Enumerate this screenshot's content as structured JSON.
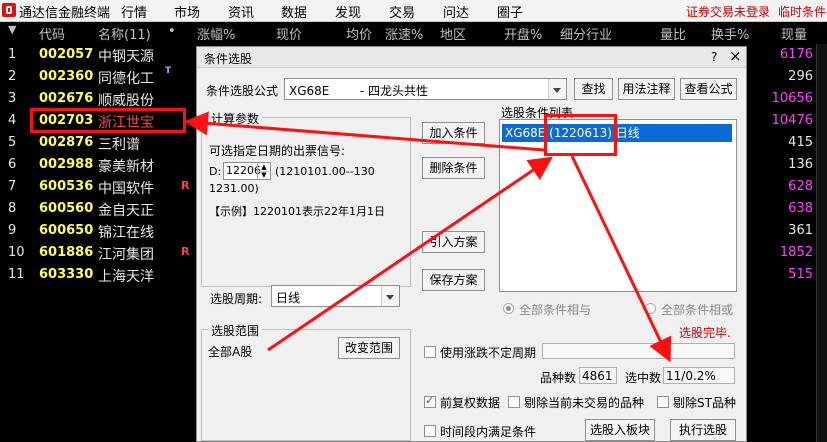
{
  "topbar": {
    "app_title": "通达信金融终端",
    "menus": [
      "行情",
      "市场",
      "资讯",
      "数据",
      "发现",
      "交易",
      "问达",
      "圈子"
    ],
    "warn_login": "证券交易未登录",
    "warn_temp": "临时条件"
  },
  "table": {
    "headers": [
      "代码",
      "名称(11)",
      "•",
      "涨幅%",
      "现价",
      "均价",
      "涨速%",
      "地区",
      "开盘%",
      "细分行业",
      "量比",
      "换手%",
      "现量"
    ],
    "rows": [
      {
        "idx": "1",
        "code": "002057",
        "name": "中钢天源",
        "flag": "",
        "right": "6176",
        "right_color": "#ff40ff"
      },
      {
        "idx": "2",
        "code": "002360",
        "name": "同德化工",
        "flag": "T",
        "right": "296",
        "right_color": "#e8e8e8"
      },
      {
        "idx": "3",
        "code": "002676",
        "name": "顺威股份",
        "flag": "",
        "right": "10656",
        "right_color": "#ff40ff"
      },
      {
        "idx": "4",
        "code": "002703",
        "name": "浙江世宝",
        "flag": "",
        "right": "10476",
        "right_color": "#ff40ff"
      },
      {
        "idx": "5",
        "code": "002876",
        "name": "三利谱",
        "flag": "",
        "right": "415",
        "right_color": "#e8e8e8"
      },
      {
        "idx": "6",
        "code": "002988",
        "name": "豪美新材",
        "flag": "",
        "right": "136",
        "right_color": "#e8e8e8"
      },
      {
        "idx": "7",
        "code": "600536",
        "name": "中国软件",
        "flag": "R",
        "right": "628",
        "right_color": "#ff40ff"
      },
      {
        "idx": "8",
        "code": "600560",
        "name": "金自天正",
        "flag": "",
        "right": "638",
        "right_color": "#ff40ff"
      },
      {
        "idx": "9",
        "code": "600650",
        "name": "锦江在线",
        "flag": "",
        "right": "361",
        "right_color": "#e8e8e8"
      },
      {
        "idx": "10",
        "code": "601886",
        "name": "江河集团",
        "flag": "R",
        "right": "1852",
        "right_color": "#ff40ff"
      },
      {
        "idx": "11",
        "code": "603330",
        "name": "上海天洋",
        "flag": "",
        "right": "515",
        "right_color": "#ff40ff"
      }
    ]
  },
  "dialog": {
    "title": "条件选股",
    "help_btn": "?",
    "close_btn": "×",
    "formula_label": "条件选股公式",
    "formula_value": "XG68E        - 四龙头共性",
    "btn_find": "查找",
    "btn_usage": "用法注释",
    "btn_view": "查看公式",
    "params_group": "计算参数",
    "param_desc": "可选指定日期的出票信号:",
    "param_d_label": "D:",
    "param_d_value": "12206",
    "param_range": "(1210101.00--130",
    "param_range2": "1231.00)",
    "param_example": "【示例】1220101表示22年1月1日",
    "btn_add": "加入条件",
    "btn_delete": "删除条件",
    "btn_import": "引入方案",
    "btn_save": "保存方案",
    "list_label": "选股条件列表",
    "list_item": "XG68E (1220613) 日线",
    "period_label": "选股周期:",
    "period_value": "日线",
    "radio_and": "全部条件相与",
    "radio_or": "全部条件相或",
    "status": "选股完毕.",
    "scope_group": "选股范围",
    "scope_value": "全部A股",
    "btn_scope": "改变范围",
    "use_period": "使用涨跌不定周期",
    "count_label": "品种数",
    "count_value": "4861",
    "hit_label": "选中数",
    "hit_value": "11/0.2%",
    "chk_fq": "前复权数据",
    "chk_exclude_untraded": "剔除当前未交易的品种",
    "chk_exclude_st": "剔除ST品种",
    "chk_period_meet": "时间段内满足条件",
    "btn_board": "选股入板块",
    "btn_run": "执行选股"
  },
  "colors": {
    "code_yellow": "#ffff54",
    "highlight_red": "#ff1010",
    "selection_blue": "#0a6ad6"
  }
}
